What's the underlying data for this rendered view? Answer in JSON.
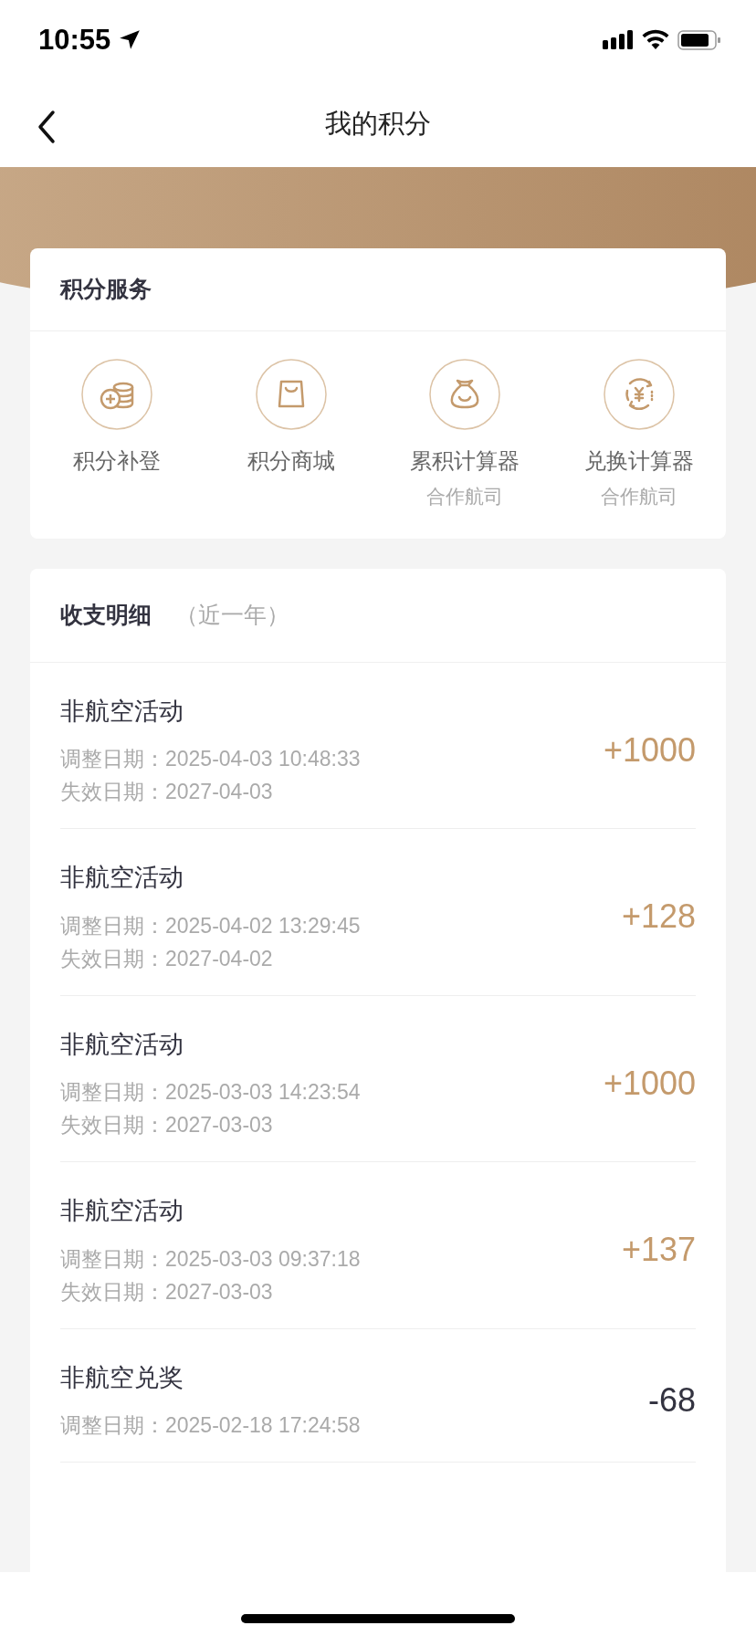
{
  "status_bar": {
    "time": "10:55"
  },
  "nav": {
    "title": "我的积分"
  },
  "services": {
    "title": "积分服务",
    "items": [
      {
        "kind": "coins",
        "label": "积分补登"
      },
      {
        "kind": "bag",
        "label": "积分商城"
      },
      {
        "kind": "pouch",
        "label": "累积计算器",
        "sublabel": "合作航司"
      },
      {
        "kind": "exchange",
        "label": "兑换计算器",
        "sublabel": "合作航司"
      }
    ]
  },
  "details": {
    "title": "收支明细",
    "period": "（近一年）",
    "rows": [
      {
        "title": "非航空活动",
        "lines": [
          "调整日期：2025-04-03 10:48:33",
          "失效日期：2027-04-03"
        ],
        "amount": "+1000",
        "kind": "credit"
      },
      {
        "title": "非航空活动",
        "lines": [
          "调整日期：2025-04-02 13:29:45",
          "失效日期：2027-04-02"
        ],
        "amount": "+128",
        "kind": "credit"
      },
      {
        "title": "非航空活动",
        "lines": [
          "调整日期：2025-03-03 14:23:54",
          "失效日期：2027-03-03"
        ],
        "amount": "+1000",
        "kind": "credit"
      },
      {
        "title": "非航空活动",
        "lines": [
          "调整日期：2025-03-03 09:37:18",
          "失效日期：2027-03-03"
        ],
        "amount": "+137",
        "kind": "credit"
      },
      {
        "title": "非航空兑奖",
        "lines": [
          "调整日期：2025-02-18 17:24:58"
        ],
        "amount": "-68",
        "kind": "debit"
      }
    ]
  }
}
